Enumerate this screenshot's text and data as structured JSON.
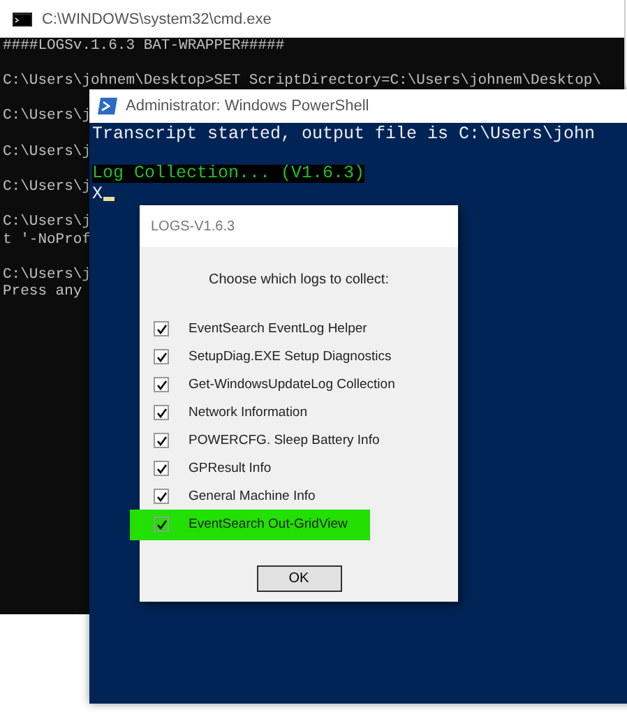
{
  "cmd_window": {
    "title": "C:\\WINDOWS\\system32\\cmd.exe",
    "blocks": [
      [
        "####LOGSv.1.6.3 BAT-WRAPPER#####"
      ],
      [
        "C:\\Users\\johnem\\Desktop>SET ScriptDirectory=C:\\Users\\johnem\\Desktop\\"
      ],
      [
        "C:\\Users\\j"
      ],
      [
        "C:\\Users\\j"
      ],
      [
        "C:\\Users\\j"
      ],
      [
        "C:\\Users\\j",
        "t '-NoProf"
      ],
      [
        "C:\\Users\\j",
        "Press any"
      ]
    ]
  },
  "powershell_window": {
    "title": "Administrator: Windows PowerShell",
    "lines": [
      {
        "kind": "plain",
        "text": "Transcript started, output file is C:\\Users\\john"
      },
      {
        "kind": "highlight",
        "text": "Log Collection... (V1.6.3)"
      },
      {
        "kind": "input",
        "text": "X"
      }
    ]
  },
  "dialog": {
    "title": "LOGS-V1.6.3",
    "prompt": "Choose which logs to collect:",
    "options": [
      {
        "label": "EventSearch EventLog Helper",
        "checked": true,
        "highlighted": false
      },
      {
        "label": "SetupDiag.EXE Setup Diagnostics",
        "checked": true,
        "highlighted": false
      },
      {
        "label": "Get-WindowsUpdateLog Collection",
        "checked": true,
        "highlighted": false
      },
      {
        "label": "Network Information",
        "checked": true,
        "highlighted": false
      },
      {
        "label": "POWERCFG. Sleep  Battery Info",
        "checked": true,
        "highlighted": false
      },
      {
        "label": "GPResult Info",
        "checked": true,
        "highlighted": false
      },
      {
        "label": "General Machine Info",
        "checked": true,
        "highlighted": false
      },
      {
        "label": "EventSearch Out-GridView",
        "checked": true,
        "highlighted": true
      }
    ],
    "button": "OK"
  }
}
